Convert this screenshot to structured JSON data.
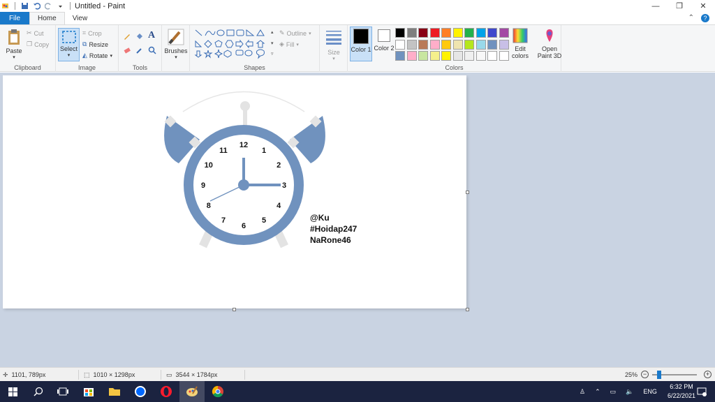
{
  "window": {
    "title": "Untitled - Paint",
    "minimize": "—",
    "restore": "❐",
    "close": "✕"
  },
  "tabs": {
    "file": "File",
    "home": "Home",
    "view": "View"
  },
  "ribbon": {
    "clipboard": {
      "label": "Clipboard",
      "paste": "Paste",
      "cut": "Cut",
      "copy": "Copy"
    },
    "image": {
      "label": "Image",
      "select": "Select",
      "crop": "Crop",
      "resize": "Resize",
      "rotate": "Rotate"
    },
    "tools": {
      "label": "Tools"
    },
    "brushes": {
      "label": "Brushes"
    },
    "shapes": {
      "label": "Shapes",
      "outline": "Outline",
      "fill": "Fill"
    },
    "size": {
      "label": "Size"
    },
    "colors": {
      "label": "Colors",
      "color1": "Color 1",
      "color1_value": "#000000",
      "color2": "Color 2",
      "color2_value": "#ffffff",
      "edit_colors": "Edit colors",
      "palette_row1": [
        "#000000",
        "#7f7f7f",
        "#880015",
        "#ed1c24",
        "#ff7f27",
        "#fff200",
        "#22b14c",
        "#00a2e8",
        "#3f48cc",
        "#a349a4"
      ],
      "palette_row2": [
        "#ffffff",
        "#c3c3c3",
        "#b97a57",
        "#ffaec9",
        "#ffc90e",
        "#efe4b0",
        "#b5e61d",
        "#99d9ea",
        "#7092be",
        "#c8bfe7"
      ],
      "palette_row3": [
        "#7092be",
        "#ffaec9",
        "#c8e6a0",
        "#f5f08c",
        "#fff200",
        "#e6e6e6",
        "#f0f0f0",
        "#f8f8f8",
        "#ffffff",
        "#ffffff"
      ]
    },
    "paint3d": "Open Paint 3D"
  },
  "canvas_text": {
    "line1": "@Ku",
    "line2": "#Hoidap247",
    "line3": "NaRone46"
  },
  "clock_numbers": [
    "12",
    "1",
    "2",
    "3",
    "4",
    "5",
    "6",
    "7",
    "8",
    "9",
    "10",
    "11"
  ],
  "statusbar": {
    "cursor_pos": "1101, 789px",
    "selection_size": "1010 × 1298px",
    "image_size": "3544 × 1784px",
    "zoom": "25%"
  },
  "taskbar": {
    "lang": "ENG",
    "time": "6:32 PM",
    "date": "6/22/2021"
  },
  "accent": "#1979ca",
  "clock_color": "#7092be"
}
